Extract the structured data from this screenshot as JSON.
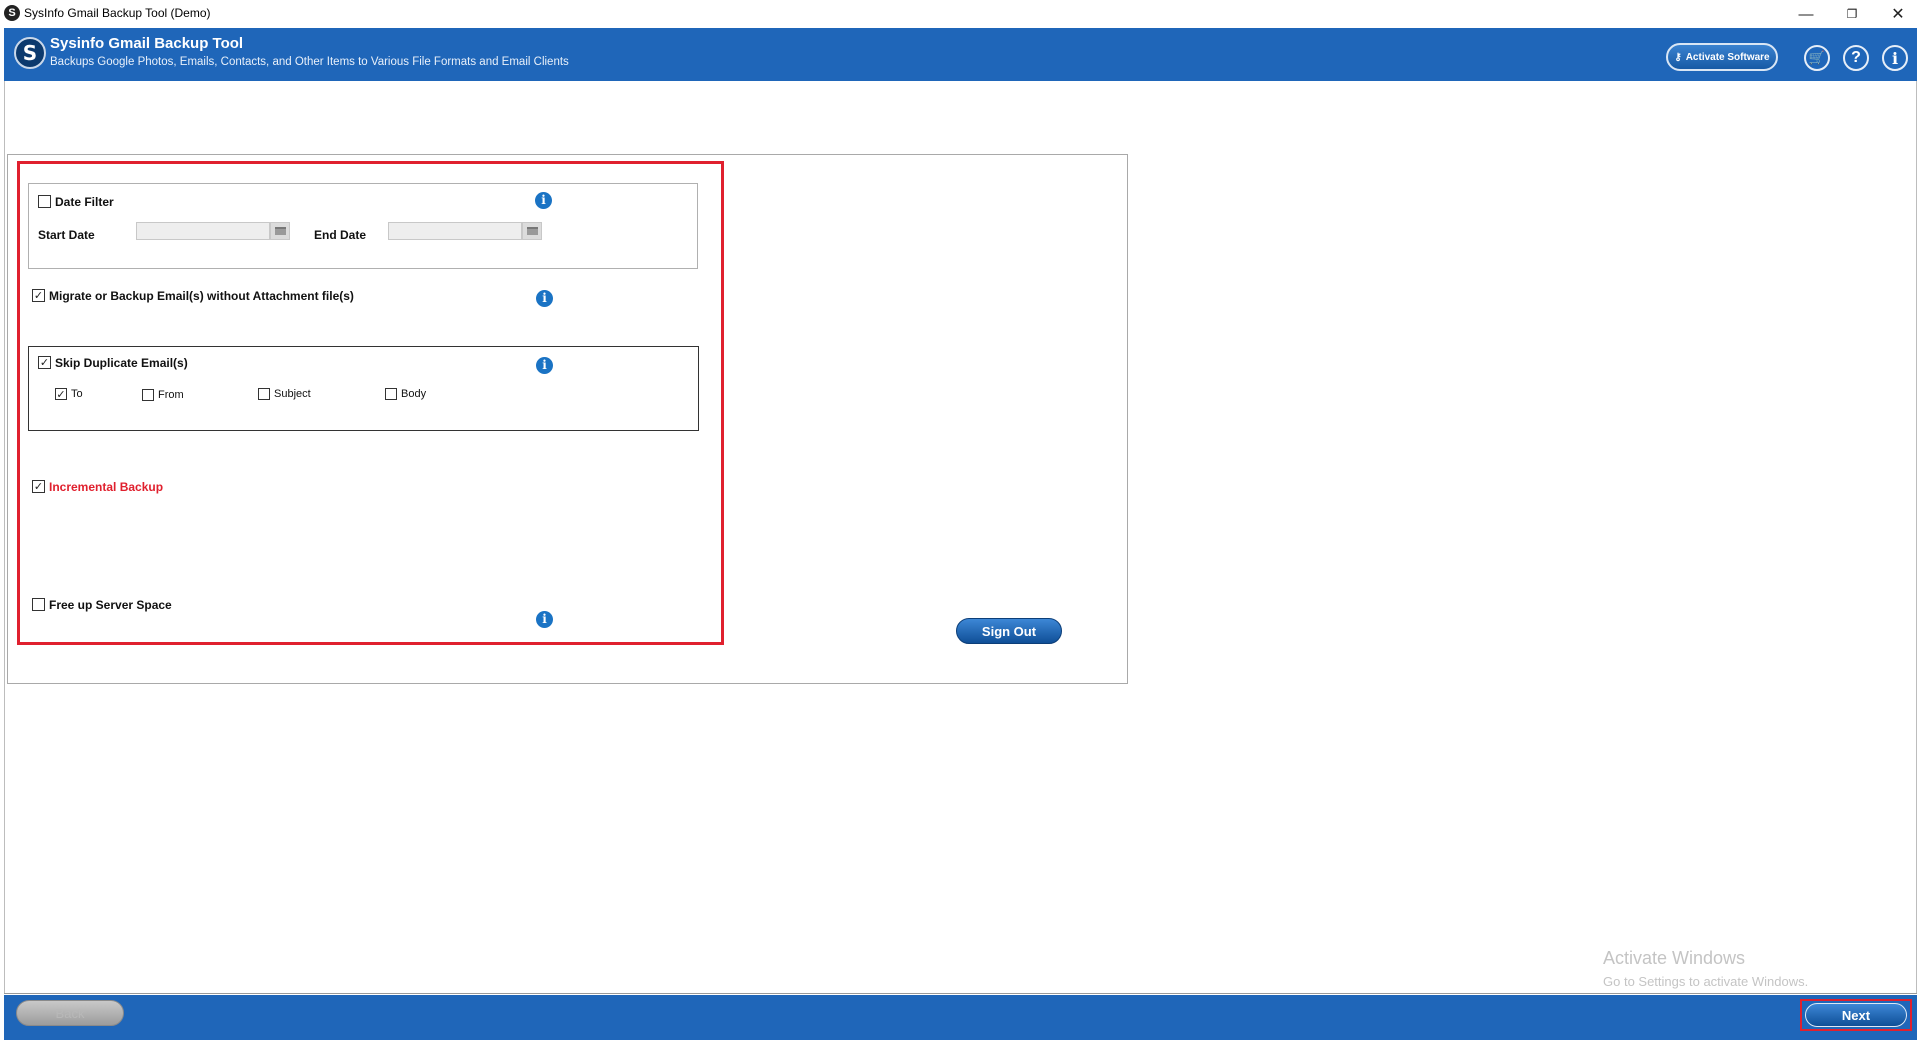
{
  "window": {
    "title": "SysInfo Gmail Backup Tool (Demo)",
    "minimize_glyph": "—",
    "maximize_glyph": "❐",
    "close_glyph": "✕"
  },
  "header": {
    "logo_letter": "S",
    "app_name": "Sysinfo Gmail Backup Tool",
    "subtitle": "Backups Google Photos, Emails, Contacts, and Other Items to Various File Formats and Email Clients",
    "activate_label": "Activate Software",
    "icons": [
      "cart-icon",
      "help-icon",
      "info-icon"
    ],
    "help_glyph": "?",
    "info_glyph": "i",
    "cart_glyph": "🛒"
  },
  "options": {
    "date_filter": {
      "label": "Date Filter",
      "checked": false
    },
    "start_date_label": "Start Date",
    "end_date_label": "End Date",
    "start_date_value": "",
    "end_date_value": "",
    "without_attachment": {
      "label": "Migrate or Backup Email(s) without Attachment file(s)",
      "checked": true
    },
    "skip_duplicate": {
      "label": "Skip Duplicate Email(s)",
      "checked": true
    },
    "dup_to": {
      "label": "To",
      "checked": true
    },
    "dup_from": {
      "label": "From",
      "checked": false
    },
    "dup_subject": {
      "label": "Subject",
      "checked": false
    },
    "dup_body": {
      "label": "Body",
      "checked": false
    },
    "incremental": {
      "label": "Incremental Backup",
      "checked": true
    },
    "free_space": {
      "label": "Free up Server Space",
      "checked": false
    },
    "info_glyph": "i"
  },
  "signout_label": "Sign Out",
  "watermark": {
    "line1": "Activate Windows",
    "line2": "Go to Settings to activate Windows."
  },
  "footer": {
    "back_label": "Back",
    "next_label": "Next"
  },
  "colors": {
    "header_blue": "#1f66b9",
    "highlight_red": "#e0202e",
    "info_blue": "#1a73c4"
  }
}
